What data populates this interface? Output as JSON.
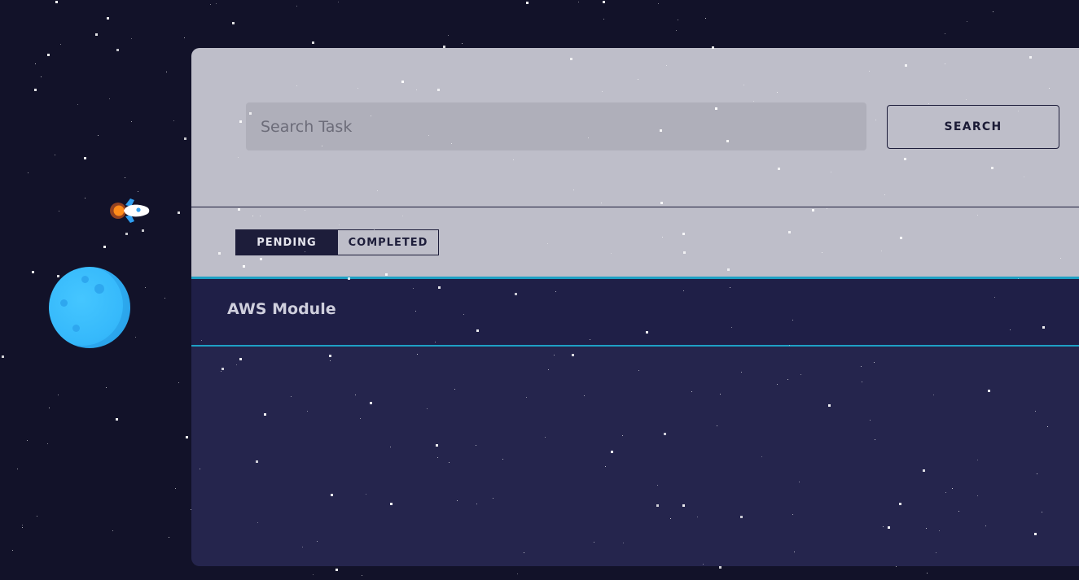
{
  "search": {
    "placeholder": "Search Task",
    "value": "",
    "button_label": "SEARCH"
  },
  "tabs": [
    {
      "label": "PENDING",
      "active": true
    },
    {
      "label": "COMPLETED",
      "active": false
    }
  ],
  "tasks": [
    {
      "title": "AWS Module"
    }
  ],
  "icons": {
    "planet": "planet-icon",
    "rocket": "rocket-icon"
  },
  "colors": {
    "background": "#121229",
    "panel_light": "#bebec9",
    "panel_dark": "#25254d",
    "accent": "#1ea0c4",
    "planet": "#36b9fb"
  }
}
